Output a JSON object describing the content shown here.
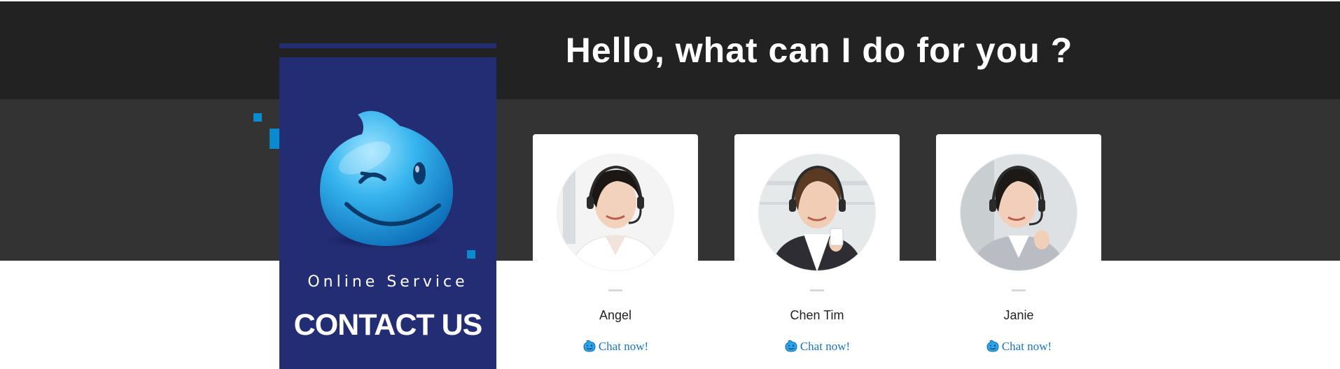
{
  "header": {
    "headline": "Hello, what can I do for you ?"
  },
  "panel": {
    "subtitle": "Online Service",
    "title": "CONTACT US",
    "mascot_icon": "winking-droplet-mascot-icon"
  },
  "colors": {
    "header_band": "#222222",
    "mid_band": "#333333",
    "panel": "#232d74",
    "accent": "#0a8bd0",
    "link": "#1a73c8"
  },
  "agents": [
    {
      "name": "Angel",
      "chat_label": "Chat now!",
      "avatar": "female-agent-headset-photo",
      "chat_icon": "smiley-chat-icon"
    },
    {
      "name": "Chen Tim",
      "chat_label": "Chat now!",
      "avatar": "female-agent-headset-photo",
      "chat_icon": "smiley-chat-icon"
    },
    {
      "name": "Janie",
      "chat_label": "Chat now!",
      "avatar": "female-agent-headset-photo",
      "chat_icon": "smiley-chat-icon"
    }
  ]
}
